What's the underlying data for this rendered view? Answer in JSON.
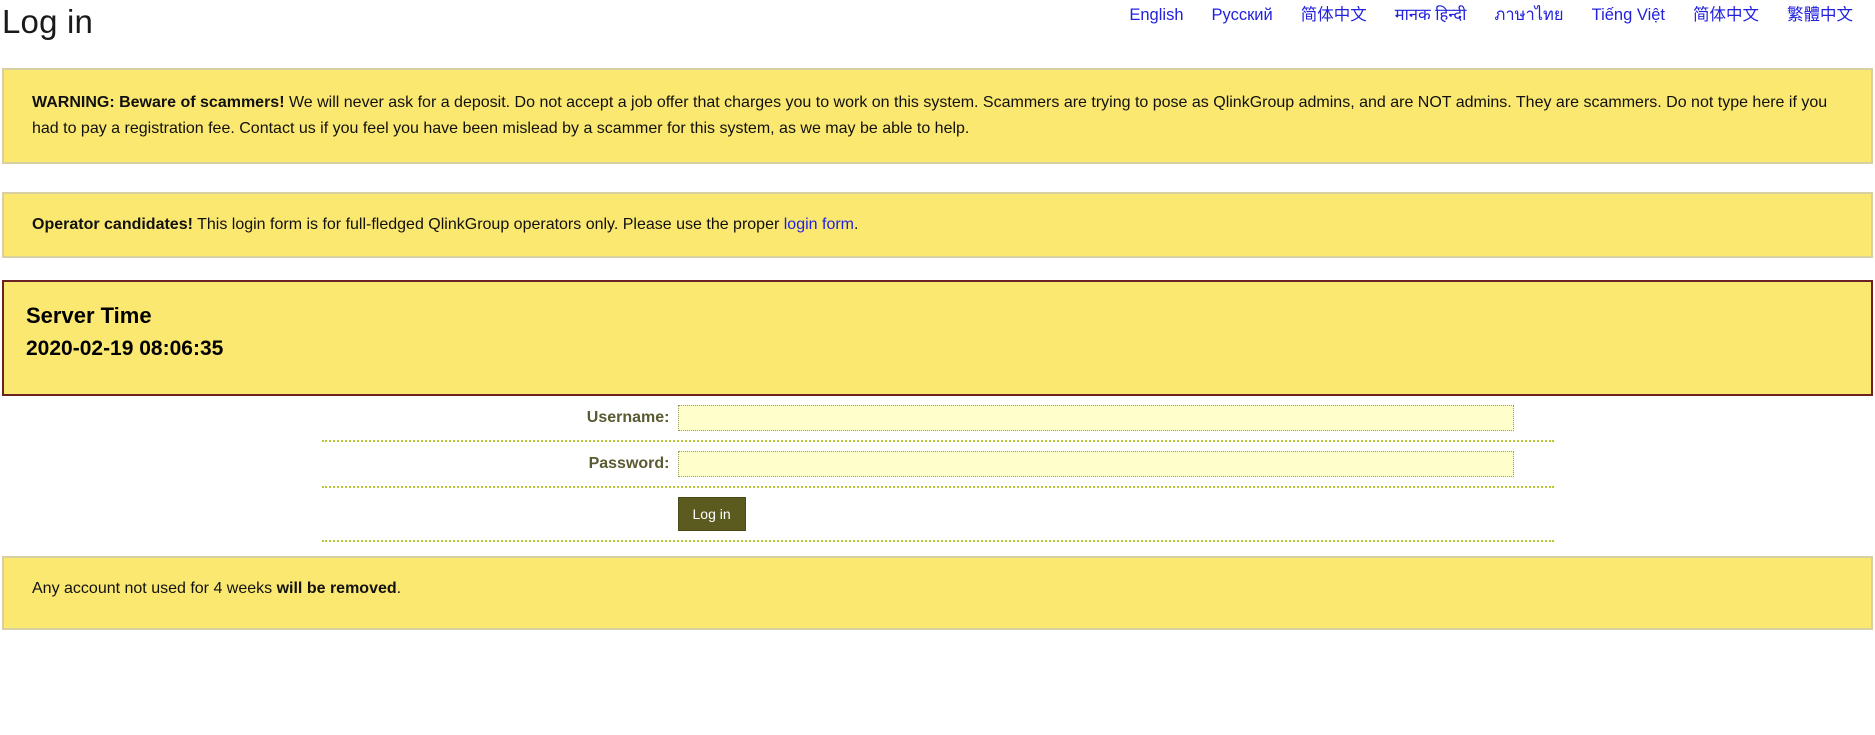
{
  "header": {
    "title": "Log in",
    "languages": [
      {
        "label": "English",
        "name": "lang-link-english"
      },
      {
        "label": "Русский",
        "name": "lang-link-russian"
      },
      {
        "label": "简体中文",
        "name": "lang-link-simplified-chinese-1"
      },
      {
        "label": "मानक हिन्दी",
        "name": "lang-link-hindi"
      },
      {
        "label": "ภาษาไทย",
        "name": "lang-link-thai"
      },
      {
        "label": "Tiếng Việt",
        "name": "lang-link-vietnamese"
      },
      {
        "label": "简体中文",
        "name": "lang-link-simplified-chinese-2"
      },
      {
        "label": "繁體中文",
        "name": "lang-link-traditional-chinese"
      }
    ]
  },
  "warning_notice": {
    "bold_lead": "WARNING: Beware of scammers!",
    "body": " We will never ask for a deposit. Do not accept a job offer that charges you to work on this system. Scammers are trying to pose as QlinkGroup admins, and are NOT admins. They are scammers. Do not type here if you had to pay a registration fee. Contact us if you feel you have been mislead by a scammer for this system, as we may be able to help."
  },
  "operator_notice": {
    "bold_lead": "Operator candidates!",
    "body_before_link": " This login form is for full-fledged QlinkGroup operators only. Please use the proper ",
    "link_text": "login form",
    "body_after_link": "."
  },
  "server_time": {
    "title": "Server Time",
    "value": "2020-02-19 08:06:35"
  },
  "login_form": {
    "username_label": "Username:",
    "username_value": "",
    "username_placeholder": "",
    "password_label": "Password:",
    "password_value": "",
    "password_placeholder": "",
    "submit_label": "Log in"
  },
  "footer_notice": {
    "text_before_bold": "Any account not used for 4 weeks ",
    "bold_text": "will be removed",
    "text_after_bold": "."
  },
  "colors": {
    "notice_background": "#fbe870",
    "notice_border": "#d8cfa3",
    "server_time_border": "#6b2222",
    "link": "#2222dd",
    "button_background": "#5b5b20",
    "input_background": "#ffffcc",
    "divider": "#b8c832"
  }
}
